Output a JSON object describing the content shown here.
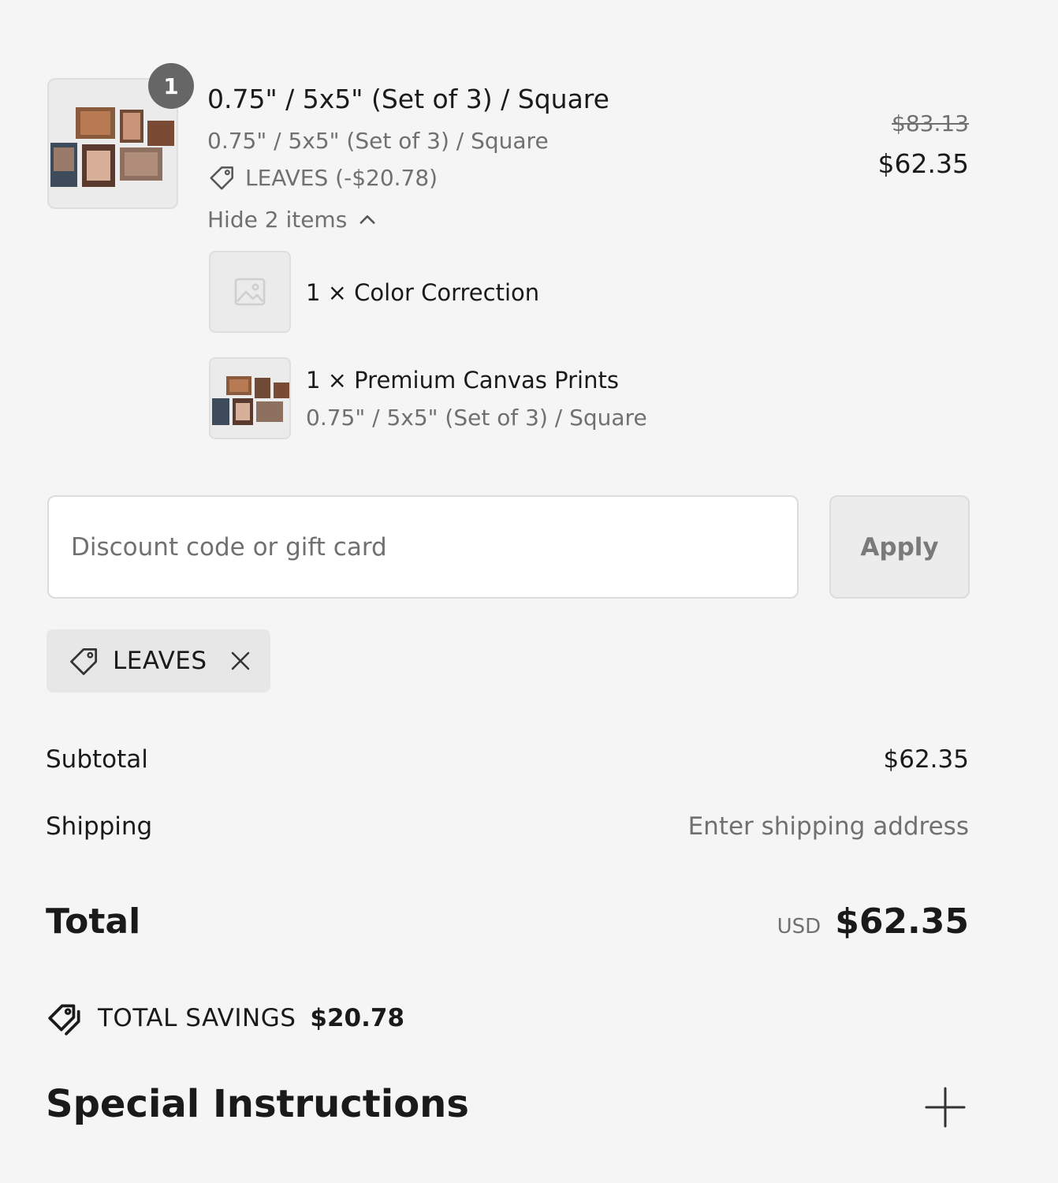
{
  "line_item": {
    "quantity": "1",
    "title": "0.75\" / 5x5\" (Set of 3) / Square",
    "variant": "0.75\" / 5x5\" (Set of 3) / Square",
    "discount_allocation": "LEAVES (-$20.78)",
    "hide_items_label": "Hide 2 items",
    "original_price": "$83.13",
    "price": "$62.35",
    "bundle_items": [
      {
        "label": "1 × Color Correction",
        "variant": ""
      },
      {
        "label": "1 × Premium Canvas Prints",
        "variant": "0.75\" / 5x5\" (Set of 3) / Square"
      }
    ]
  },
  "discount": {
    "placeholder": "Discount code or gift card",
    "value": "",
    "apply_label": "Apply",
    "applied_code": "LEAVES"
  },
  "summary": {
    "subtotal_label": "Subtotal",
    "subtotal_value": "$62.35",
    "shipping_label": "Shipping",
    "shipping_value": "Enter shipping address",
    "total_label": "Total",
    "total_currency": "USD",
    "total_value": "$62.35",
    "savings_label": "TOTAL SAVINGS",
    "savings_value": "$20.78"
  },
  "special_instructions": {
    "title": "Special Instructions"
  },
  "colors": {
    "background": "#f5f5f5",
    "text_primary": "#1a1a1a",
    "text_secondary": "#707070",
    "badge": "#666666",
    "chip": "#e7e7e7"
  },
  "icons": [
    "tag-icon",
    "chevron-up-icon",
    "image-placeholder-icon",
    "close-icon",
    "tags-icon",
    "plus-icon"
  ]
}
